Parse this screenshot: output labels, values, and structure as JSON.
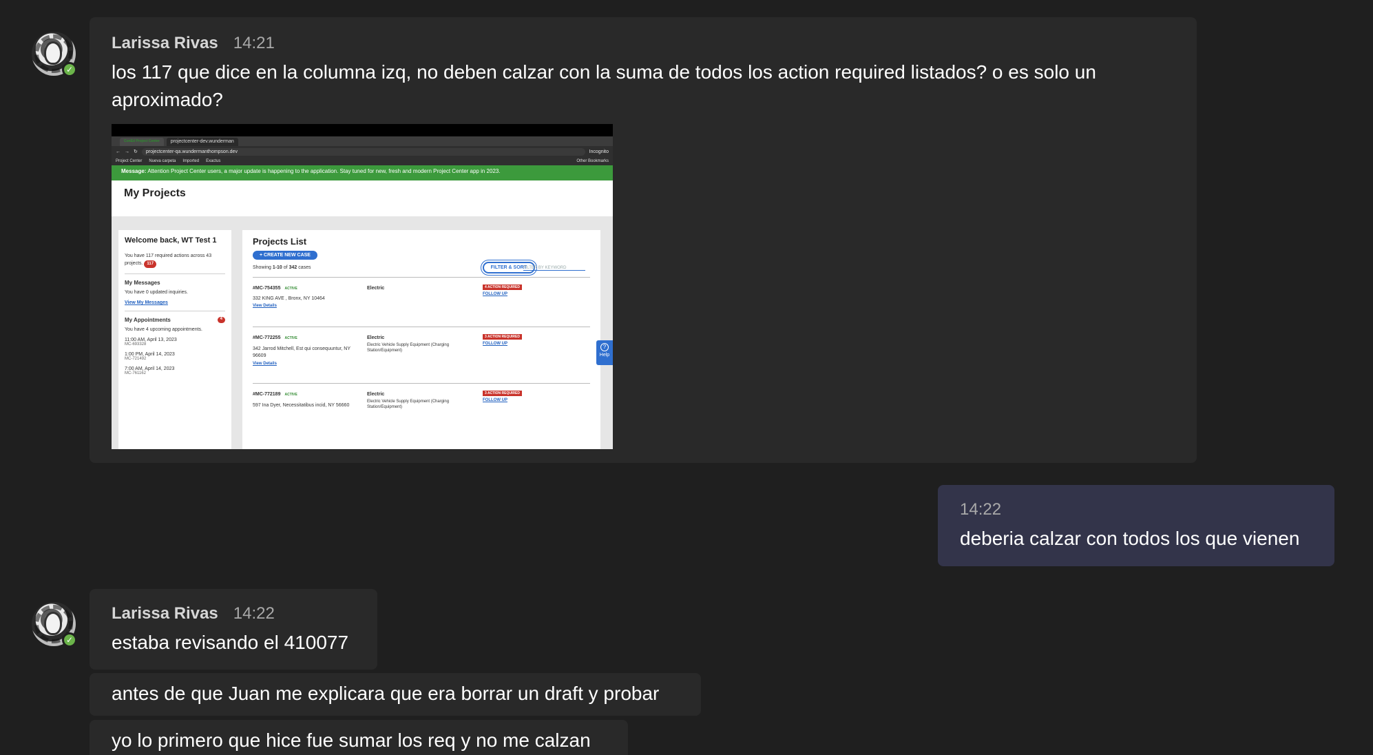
{
  "messages": [
    {
      "sender": "Larissa Rivas",
      "time": "14:21",
      "text": "los 117 que dice en la columna izq, no deben calzar con la suma de todos los action required listados? o es solo un aproximado?"
    },
    {
      "time": "14:22",
      "text": "deberia calzar con todos los que vienen"
    },
    {
      "sender": "Larissa Rivas",
      "time": "14:22",
      "text": "estaba revisando el 410077"
    },
    {
      "text": "antes de que Juan me explicara que era borrar un draft y probar"
    },
    {
      "text": "yo lo primero que hice fue sumar los req y no me calzan"
    }
  ],
  "screenshot": {
    "tabs": [
      "ConEd Project Center",
      "projectcenter-dev.wunderman"
    ],
    "url": "projectcenter-qa.wundermanthompson.dev",
    "incognito": "Incognito",
    "bookmarks": [
      "Project Center",
      "Nueva carpeta",
      "Imported",
      "Exactus"
    ],
    "other_bookmarks": "Other Bookmarks",
    "banner_label": "Message:",
    "banner_text": "Attention Project Center users, a major update is happening to the application. Stay tuned for new, fresh and modern Project Center app in 2023.",
    "page_title": "My Projects",
    "welcome": "Welcome back, WT Test 1",
    "actions_text": "You have 117 required actions across 43 projects.",
    "actions_count": "117",
    "messages_title": "My Messages",
    "messages_text": "You have 0 updated inquiries.",
    "messages_link": "View My Messages",
    "appointments_title": "My Appointments",
    "appointments_count": "4",
    "appointments_text": "You have 4 upcoming appointments.",
    "appointments": [
      {
        "when": "11:00 AM, April 13, 2023",
        "id": "MC-693328"
      },
      {
        "when": "1:00 PM, April 14, 2023",
        "id": "MC-721492"
      },
      {
        "when": "7:00 AM, April 14, 2023",
        "id": "MC-761162"
      }
    ],
    "list_title": "Projects List",
    "create_button": "+ CREATE NEW CASE",
    "filter_button": "FILTER & SORT",
    "filter_placeholder": "FILTER BY KEYWORD",
    "showing_prefix": "Showing",
    "showing_range": "1-10",
    "showing_of": "of",
    "showing_total": "342",
    "showing_suffix": "cases",
    "status_active": "ACTIVE",
    "view_details": "View Details",
    "follow_up": "FOLLOW UP",
    "projects": [
      {
        "id": "#MC-754355",
        "address": "332 KING AVE , Bronx, NY 10464",
        "type": "Electric",
        "subtype": "",
        "actions": "4 ACTION REQUIRED"
      },
      {
        "id": "#MC-772255",
        "address": "342 Jarrod Mitchell, Est qui consequuntur, NY 96609",
        "type": "Electric",
        "subtype": "Electric Vehicle Supply Equipment (Charging Station/Equipment)",
        "actions": "3 ACTION REQUIRED"
      },
      {
        "id": "#MC-772189",
        "address": "597 Ina Dyer, Necessitatibus incid, NY 56660",
        "type": "Electric",
        "subtype": "Electric Vehicle Supply Equipment (Charging Station/Equipment)",
        "actions": "3 ACTION REQUIRED"
      }
    ],
    "help": "Help"
  }
}
